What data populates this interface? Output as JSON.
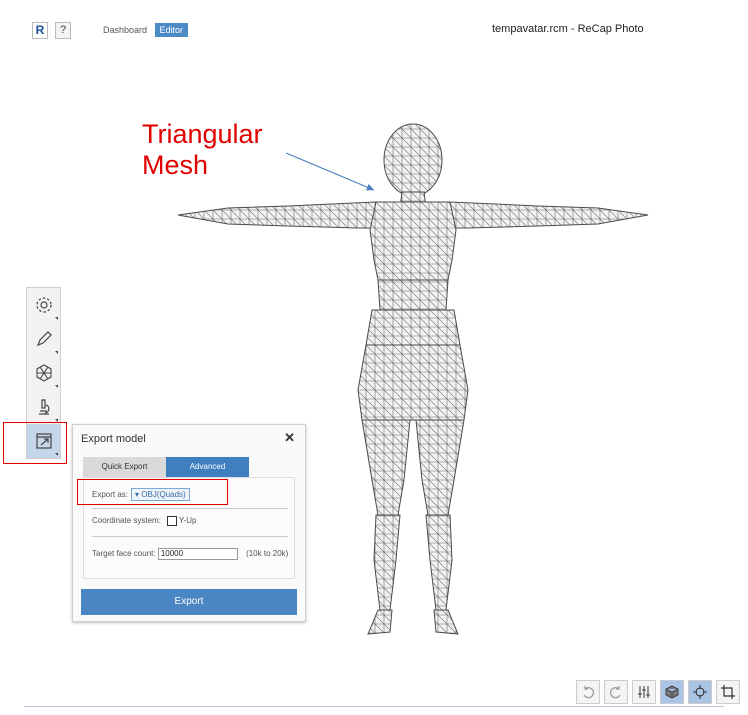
{
  "header": {
    "logo_letter": "R",
    "help_label": "?",
    "nav_dashboard": "Dashboard",
    "nav_editor": "Editor",
    "app_title": "tempavatar.rcm - ReCap Photo"
  },
  "annotation": {
    "line1": "Triangular",
    "line2": "Mesh",
    "color": "#e00000"
  },
  "toolbar": {
    "tools": [
      "gear-icon",
      "pencil-icon",
      "hexagon-icon",
      "microscope-icon",
      "export-icon"
    ],
    "active_tool": "export-icon"
  },
  "panel": {
    "title": "Export model",
    "close_label": "✕",
    "tab_quick": "Quick Export",
    "tab_advanced": "Advanced",
    "export_as_label": "Export as:",
    "export_as_value": "▾ OBJ(Quads)",
    "coord_label": "Coordinate system:",
    "yup_label": "Y-Up",
    "face_count_label": "Target face count:",
    "face_count_value": "10000",
    "face_count_hint": "(10k to 20k)",
    "export_button": "Export"
  },
  "bottom_toolbar": {
    "tools": [
      "undo-icon",
      "redo-icon",
      "sliders-icon",
      "cube-icon",
      "crosshair-icon",
      "crop-icon"
    ],
    "accent": "#4a85c4"
  }
}
